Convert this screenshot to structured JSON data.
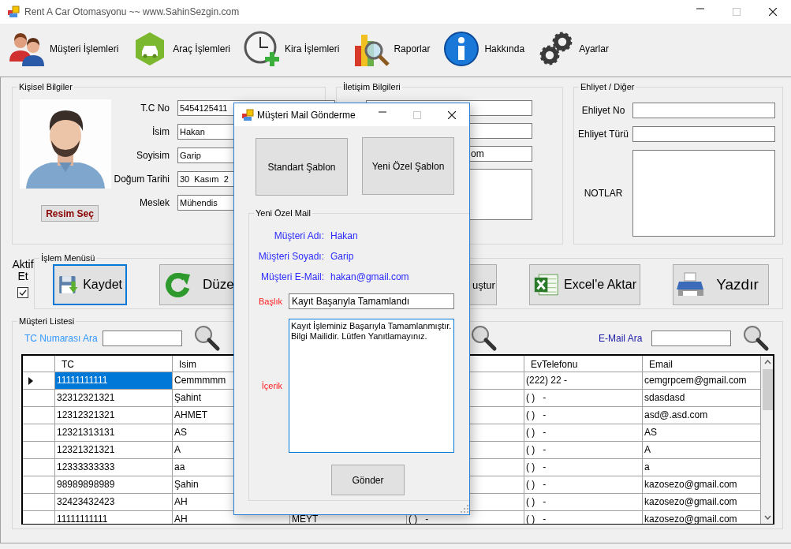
{
  "window": {
    "title": "Rent A Car Otomasyonu ~~ www.SahinSezgin.com",
    "maximize_disabled": true
  },
  "toolbar": [
    {
      "label": "Müşteri İşlemleri"
    },
    {
      "label": "Araç İşlemleri"
    },
    {
      "label": "Kira İşlemleri"
    },
    {
      "label": "Raporlar"
    },
    {
      "label": "Hakkında"
    },
    {
      "label": "Ayarlar"
    }
  ],
  "personal": {
    "title": "Kişisel Bilgiler",
    "photo_button": "Resim Seç",
    "fields": [
      {
        "label": "T.C No",
        "value": "5454125411"
      },
      {
        "label": "İsim",
        "value": "Hakan"
      },
      {
        "label": "Soyisim",
        "value": "Garip"
      },
      {
        "label": "Doğum Tarihi",
        "value": "30  Kasım  2"
      },
      {
        "label": "Meslek",
        "value": "Mühendis"
      }
    ]
  },
  "contact": {
    "title": "İletişim Bilgileri",
    "fields": [
      {
        "kind": "input"
      },
      {
        "kind": "input"
      },
      {
        "kind": "input",
        "value": "om"
      },
      {
        "kind": "textarea"
      }
    ]
  },
  "license": {
    "title": "Ehliyet / Diğer",
    "fields": [
      {
        "label": "Ehliyet No",
        "kind": "input"
      },
      {
        "label": "Ehliyet Türü",
        "kind": "input"
      },
      {
        "label": "NOTLAR",
        "kind": "textarea"
      }
    ]
  },
  "active": {
    "label": "Aktif Et",
    "checked": true
  },
  "actions": {
    "title": "İşlem Menüsü",
    "buttons": [
      {
        "label": "Kaydet",
        "focused": true
      },
      {
        "label": "Düze",
        "focused": false
      },
      {
        "label": "uştur",
        "focused": false
      },
      {
        "label": "Excel'e Aktar",
        "focused": false
      },
      {
        "label": "Yazdır",
        "focused": false
      }
    ]
  },
  "customers": {
    "title": "Müşteri Listesi",
    "searches": [
      {
        "label": "TC Numarası Ara"
      },
      {
        "label": "E-Mail Ara"
      }
    ],
    "table": {
      "columns": [
        "TC",
        "Isim",
        null,
        null,
        "EvTelefonu",
        "Email"
      ],
      "rows": [
        {
          "selected": true,
          "cells": [
            "11111111111",
            "Cemmmmm",
            null,
            null,
            "(222) 22 -",
            "cemgrpcem@gmail.com"
          ]
        },
        {
          "selected": false,
          "cells": [
            "32312321321",
            "Şahint",
            null,
            null,
            "( )   -",
            "sdasdasd"
          ]
        },
        {
          "selected": false,
          "cells": [
            "12312321321",
            "AHMET",
            null,
            null,
            "( )   -",
            "asd@.asd.com"
          ]
        },
        {
          "selected": false,
          "cells": [
            "12321313131",
            "AS",
            null,
            null,
            "( )   -",
            "AS"
          ]
        },
        {
          "selected": false,
          "cells": [
            "12321321321",
            "A",
            null,
            null,
            "( )   -",
            "A"
          ]
        },
        {
          "selected": false,
          "cells": [
            "12333333333",
            "aa",
            null,
            null,
            "( )   -",
            "a"
          ]
        },
        {
          "selected": false,
          "cells": [
            "98989898989",
            "Şahin",
            null,
            null,
            "( )   -",
            "kazosezo@gmail.com"
          ]
        },
        {
          "selected": false,
          "cells": [
            "32423432423",
            "AH",
            null,
            null,
            "( )   -",
            "kazosezo@gmail.com"
          ]
        },
        {
          "selected": false,
          "cells": [
            "11111111111",
            "AH",
            "MEYT",
            "( )   -",
            "( )   -",
            "kazosezo@gmail.com"
          ]
        }
      ]
    }
  },
  "dialog": {
    "title": "Müşteri Mail Gönderme",
    "maximize_disabled": true,
    "template_buttons": [
      "Standart Şablon",
      "Yeni Özel Şablon"
    ],
    "group": "Yeni Özel Mail",
    "info": [
      {
        "label": "Müşteri Adı:",
        "value": "Hakan"
      },
      {
        "label": "Müşteri Soyadı:",
        "value": "Garip"
      },
      {
        "label": "Müşteri E-Mail:",
        "value": "hakan@gmail.com"
      }
    ],
    "subject": {
      "label": "Başlık",
      "value": "Kayıt Başarıyla Tamamlandı"
    },
    "content": {
      "label": "İçerik",
      "value": "Kayıt İşleminiz Başarıyla Tamamlanmıştır. Bilgi Mailidir. Lütfen Yanıtlamayınız."
    },
    "send_button": "Gönder"
  }
}
